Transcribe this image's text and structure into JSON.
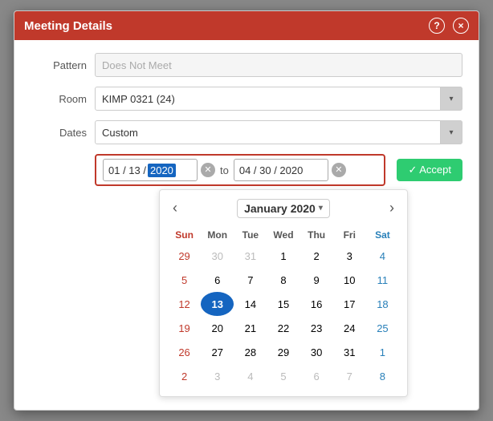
{
  "dialog": {
    "title": "Meeting Details",
    "help_icon": "?",
    "close_icon": "×"
  },
  "form": {
    "pattern_label": "Pattern",
    "pattern_value": "Does Not Meet",
    "room_label": "Room",
    "room_value": "KIMP 0321 (24)",
    "dates_label": "Dates",
    "dates_value": "Custom"
  },
  "date_range": {
    "from_date": "01 / 13 /",
    "from_year": "2020",
    "to_date": "04 / 30 / 2020",
    "separator": "to",
    "accept_label": "✓ Accept"
  },
  "calendar": {
    "month_year": "January 2020",
    "prev_icon": "‹",
    "next_icon": "›",
    "dropdown_arrow": "▾",
    "days_headers": [
      "Sun",
      "Mon",
      "Tue",
      "Wed",
      "Thu",
      "Fri",
      "Sat"
    ],
    "weeks": [
      [
        {
          "day": "29",
          "class": "other-month sun-col"
        },
        {
          "day": "30",
          "class": "other-month"
        },
        {
          "day": "31",
          "class": "other-month"
        },
        {
          "day": "1",
          "class": ""
        },
        {
          "day": "2",
          "class": ""
        },
        {
          "day": "3",
          "class": ""
        },
        {
          "day": "4",
          "class": "sat-col"
        }
      ],
      [
        {
          "day": "5",
          "class": "sun-col"
        },
        {
          "day": "6",
          "class": ""
        },
        {
          "day": "7",
          "class": ""
        },
        {
          "day": "8",
          "class": ""
        },
        {
          "day": "9",
          "class": ""
        },
        {
          "day": "10",
          "class": ""
        },
        {
          "day": "11",
          "class": "sat-col"
        }
      ],
      [
        {
          "day": "12",
          "class": "sun-col"
        },
        {
          "day": "13",
          "class": "selected"
        },
        {
          "day": "14",
          "class": ""
        },
        {
          "day": "15",
          "class": ""
        },
        {
          "day": "16",
          "class": ""
        },
        {
          "day": "17",
          "class": ""
        },
        {
          "day": "18",
          "class": "sat-col"
        }
      ],
      [
        {
          "day": "19",
          "class": "sun-col"
        },
        {
          "day": "20",
          "class": ""
        },
        {
          "day": "21",
          "class": ""
        },
        {
          "day": "22",
          "class": ""
        },
        {
          "day": "23",
          "class": ""
        },
        {
          "day": "24",
          "class": ""
        },
        {
          "day": "25",
          "class": "sat-col"
        }
      ],
      [
        {
          "day": "26",
          "class": "sun-col"
        },
        {
          "day": "27",
          "class": ""
        },
        {
          "day": "28",
          "class": ""
        },
        {
          "day": "29",
          "class": ""
        },
        {
          "day": "30",
          "class": ""
        },
        {
          "day": "31",
          "class": ""
        },
        {
          "day": "1",
          "class": "other-month sat-col"
        }
      ],
      [
        {
          "day": "2",
          "class": "other-month sun-col"
        },
        {
          "day": "3",
          "class": "other-month"
        },
        {
          "day": "4",
          "class": "other-month"
        },
        {
          "day": "5",
          "class": "other-month"
        },
        {
          "day": "6",
          "class": "other-month"
        },
        {
          "day": "7",
          "class": "other-month"
        },
        {
          "day": "8",
          "class": "other-month sat-col"
        }
      ]
    ]
  }
}
